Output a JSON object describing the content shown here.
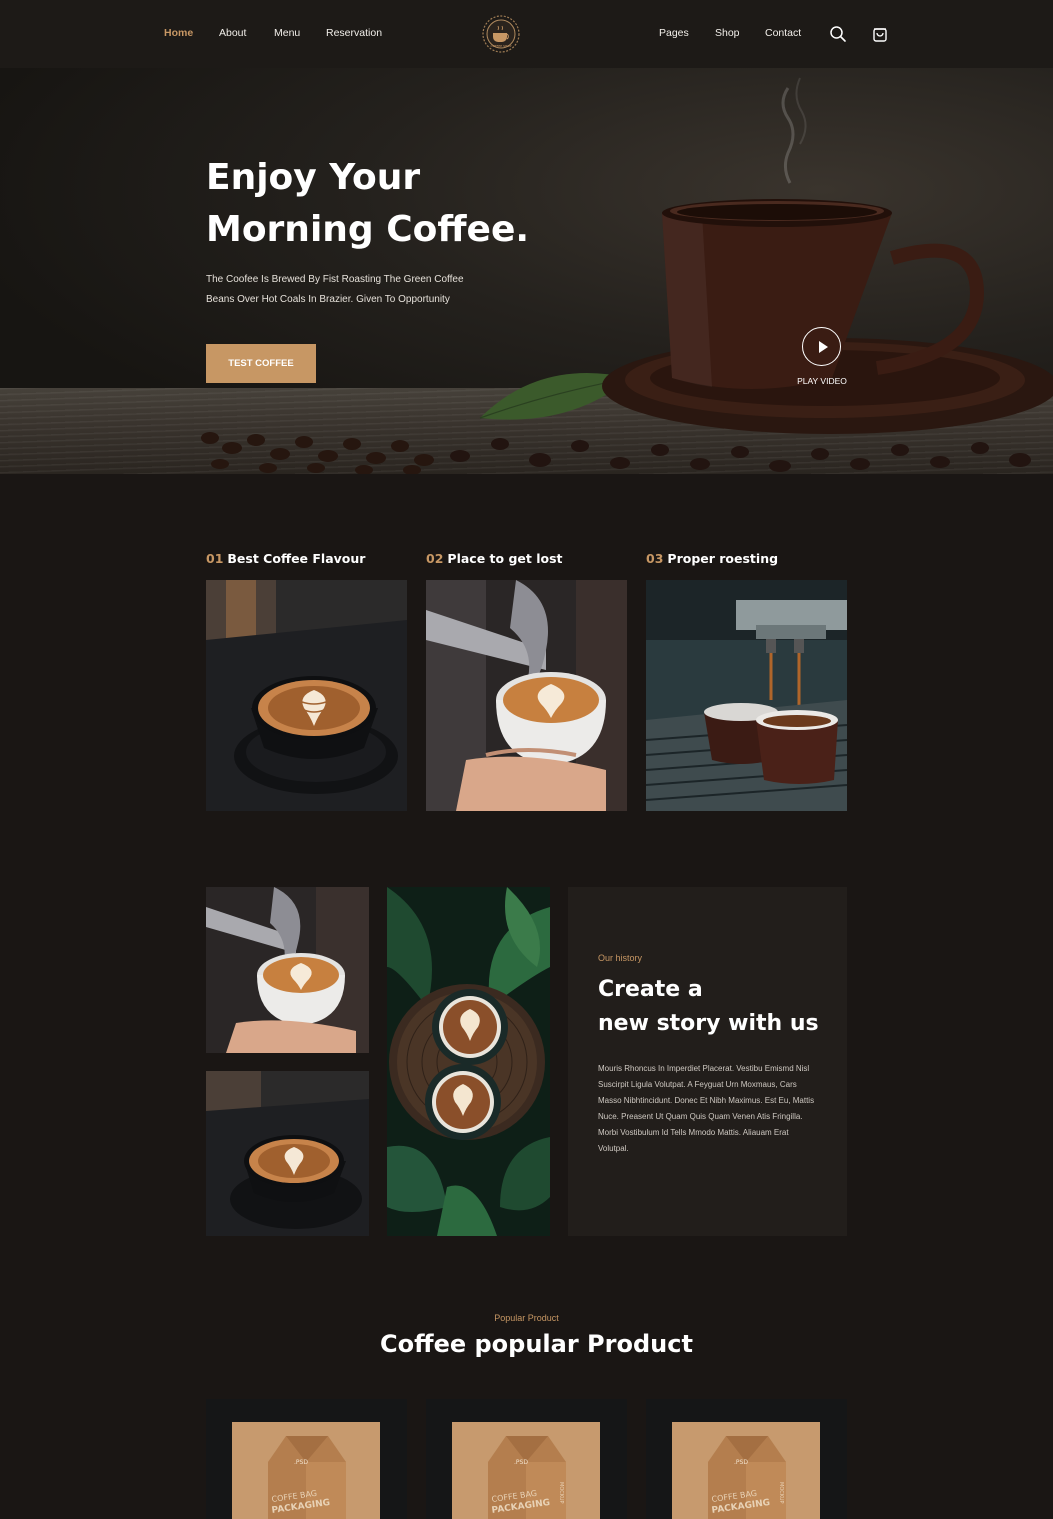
{
  "nav": {
    "left_items": [
      "Home",
      "About",
      "Menu",
      "Reservation"
    ],
    "right_items": [
      "Pages",
      "Shop",
      "Contact"
    ],
    "active_item": "Home",
    "logo_text": "COFFEE SHOP",
    "icons": [
      "search-icon",
      "cart-icon"
    ]
  },
  "hero": {
    "title_line1": "Enjoy Your",
    "title_line2": "Morning Coffee.",
    "subtitle_line1": "The Coofee Is Brewed By Fist Roasting The Green Coffee",
    "subtitle_line2": "Beans Over Hot Coals In Brazier. Given To Opportunity",
    "cta_label": "TEST COFFEE",
    "play_label": "PLAY VIDEO"
  },
  "features": [
    {
      "num": "01",
      "title": "Best Coffee Flavour"
    },
    {
      "num": "02",
      "title": "Place to get lost"
    },
    {
      "num": "03",
      "title": "Proper roesting"
    }
  ],
  "story": {
    "kicker": "Our history",
    "title_line1": "Create a",
    "title_line2": "new story with us",
    "body": "Mouris Rhoncus In Imperdiet Placerat. Vestibu Emismd Nisl Suscirpit Ligula Volutpat. A Feyguat Urn Moxmaus, Cars Masso Nibhtincidunt. Donec Et Nibh Maximus. Est Eu, Mattis Nuce. Preasent Ut Quam Quis Quam Venen Atis Fringilla. Morbi Vostibulum Id Tells Mmodo Mattis. Aliauam Erat Volutpal."
  },
  "products": {
    "kicker": "Popular Product",
    "title": "Coffee popular Product",
    "items": [
      {
        "bag_tag": ".PSD",
        "bag_text_line1": "COFFE BAG",
        "bag_text_line2": "PACKAGING",
        "bag_side": ""
      },
      {
        "bag_tag": ".PSD",
        "bag_text_line1": "COFFE BAG",
        "bag_text_line2": "PACKAGING",
        "bag_side": "MOCKUP"
      },
      {
        "bag_tag": ".PSD",
        "bag_text_line1": "COFFE BAG",
        "bag_text_line2": "PACKAGING",
        "bag_side": "MOCKUP"
      }
    ]
  },
  "colors": {
    "accent": "#c79764",
    "background": "#1a1614",
    "nav_bg": "#1d1a17",
    "story_box": "#221e1b",
    "product_card": "#151617"
  }
}
